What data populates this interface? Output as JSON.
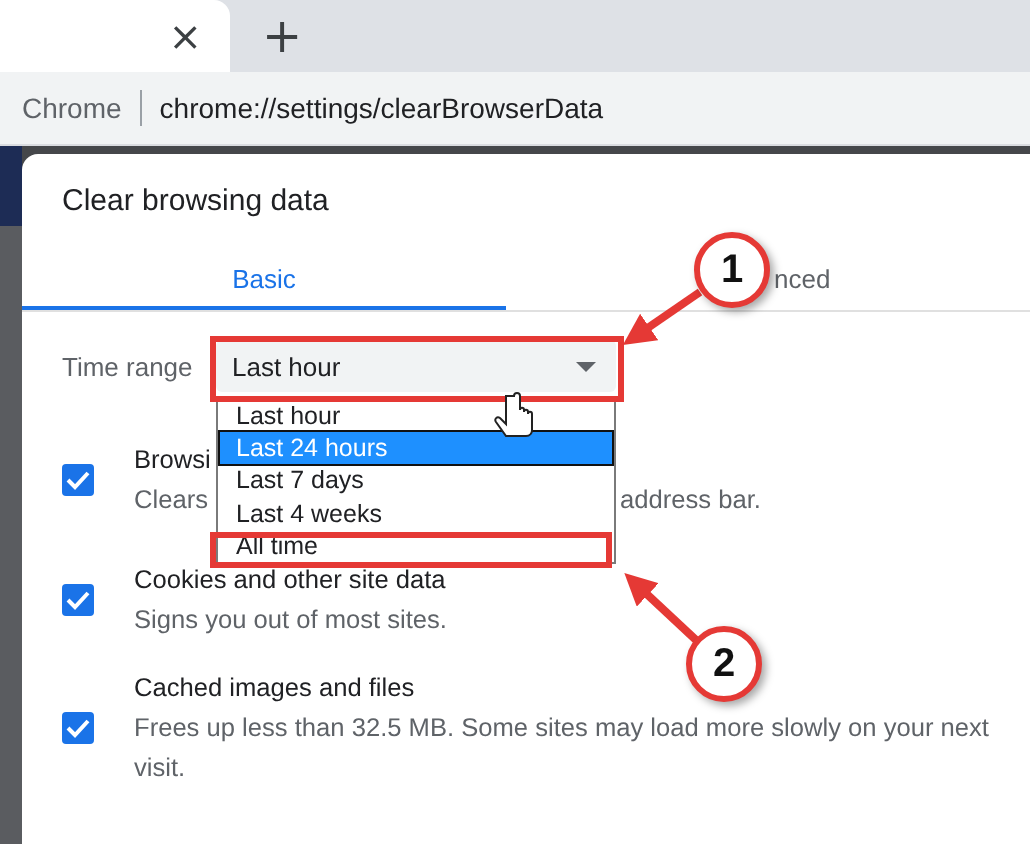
{
  "browser": {
    "tab_close": "×",
    "new_tab": "+",
    "site_label": "Chrome",
    "url": "chrome://settings/clearBrowserData"
  },
  "dialog": {
    "title": "Clear browsing data",
    "tabs": [
      {
        "label": "Basic",
        "selected": true
      },
      {
        "label": "nced",
        "selected": false
      }
    ],
    "time_range": {
      "label": "Time range",
      "value": "Last hour"
    },
    "options": [
      {
        "title": "Browsi",
        "description": "Clears",
        "description_end": "address bar.",
        "checked": true
      },
      {
        "title": "Cookies and other site data",
        "description": "Signs you out of most sites.",
        "checked": true
      },
      {
        "title": "Cached images and files",
        "description": "Frees up less than 32.5 MB. Some sites may load more slowly on your next visit.",
        "checked": true
      }
    ]
  },
  "dropdown": [
    {
      "label": "Last hour",
      "selected": false
    },
    {
      "label": "Last 24 hours",
      "selected": true
    },
    {
      "label": "Last 7 days",
      "selected": false
    },
    {
      "label": "Last 4 weeks",
      "selected": false
    },
    {
      "label": "All time",
      "selected": false
    }
  ],
  "annotations": [
    {
      "number": "1"
    },
    {
      "number": "2"
    }
  ]
}
